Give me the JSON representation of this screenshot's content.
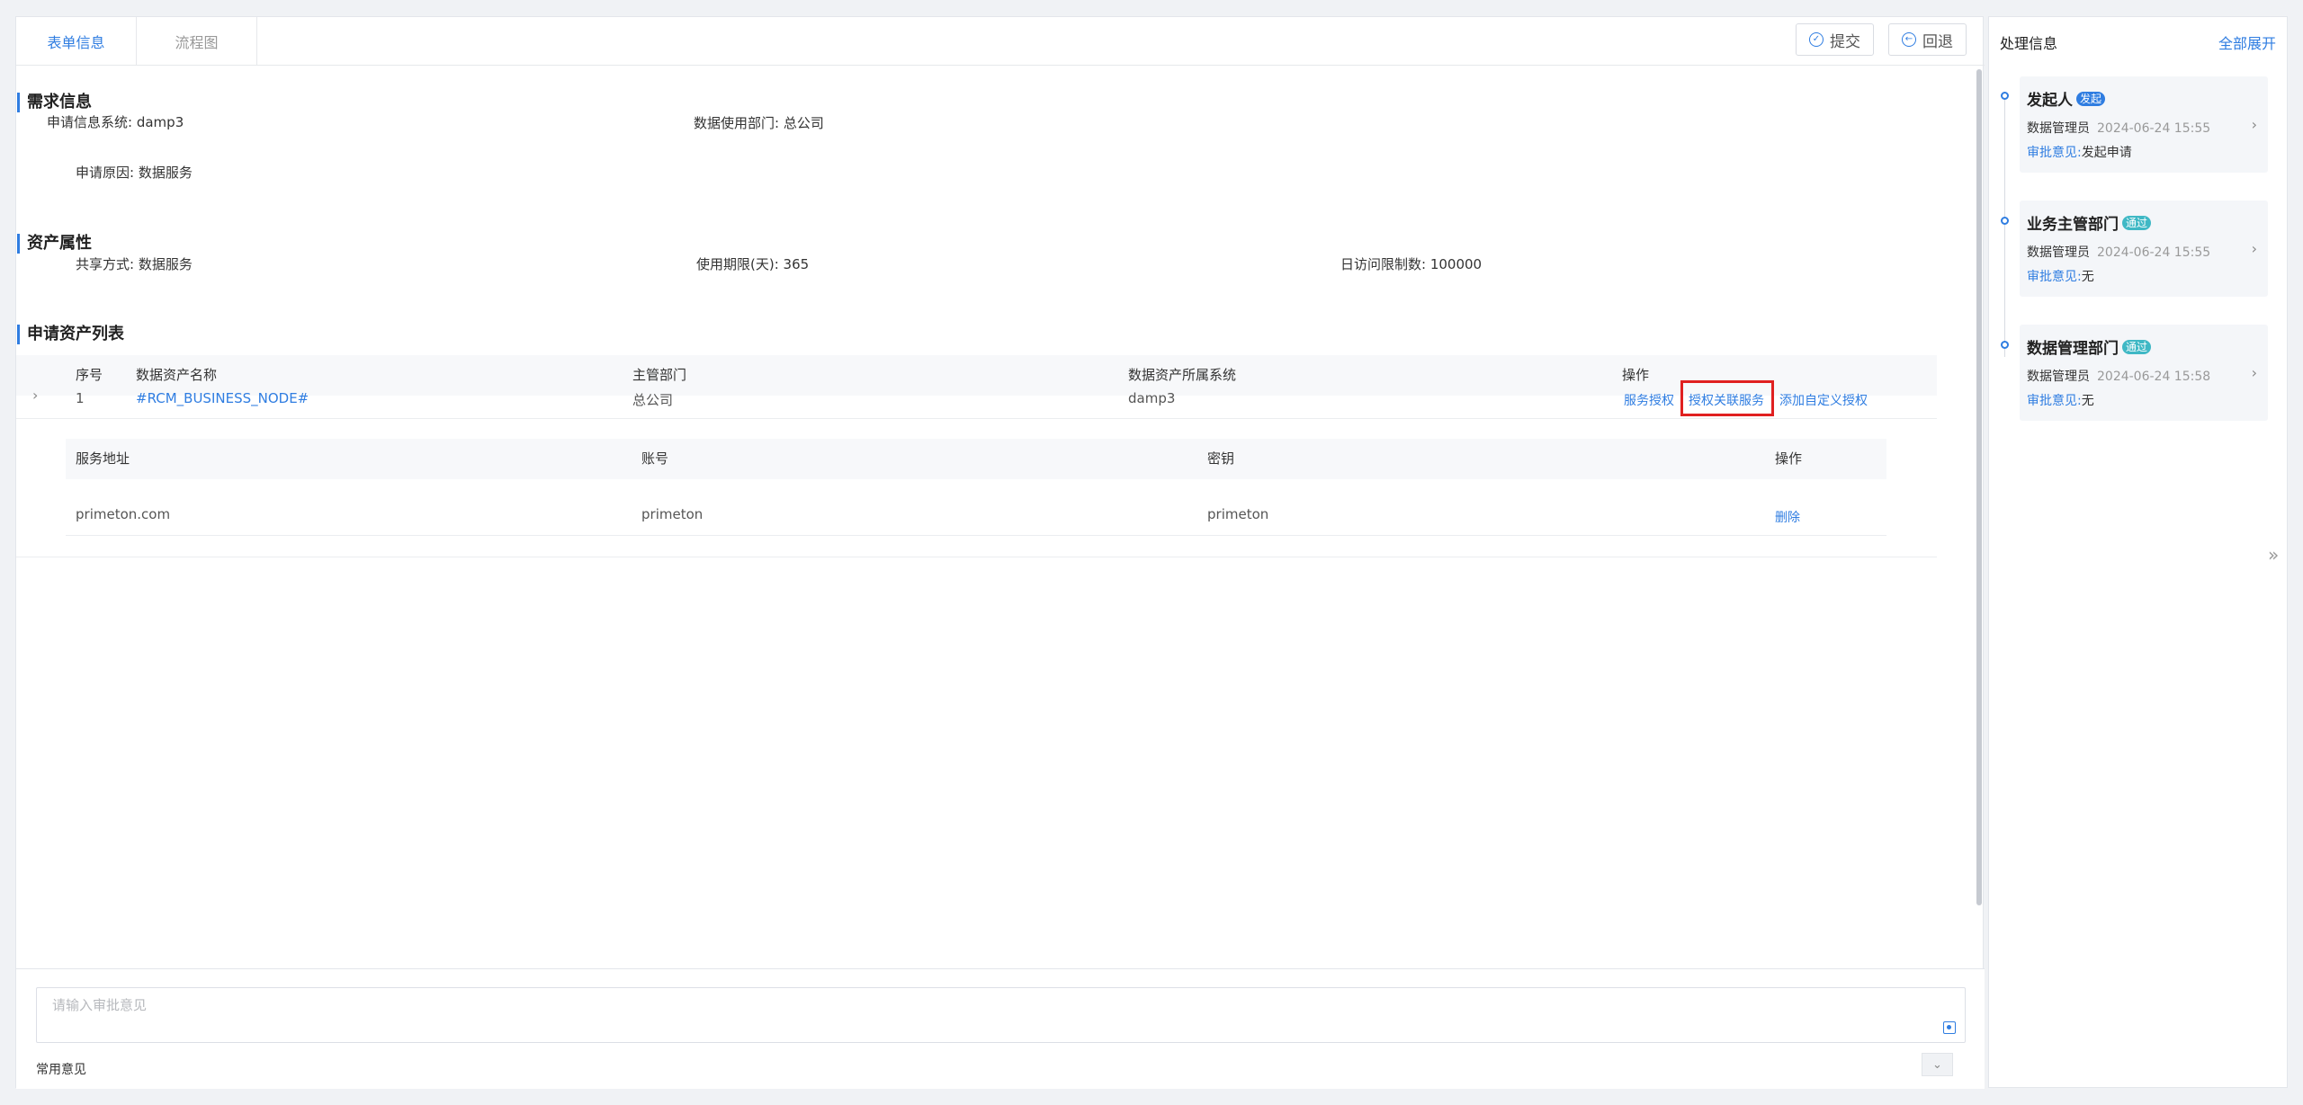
{
  "tabs": [
    {
      "label": "表单信息",
      "active": true
    },
    {
      "label": "流程图",
      "active": false
    }
  ],
  "toolbar": {
    "submit_label": "提交",
    "back_label": "回退"
  },
  "demand": {
    "title": "需求信息",
    "system_label": "申请信息系统:",
    "system_value": "damp3",
    "dept_label": "数据使用部门:",
    "dept_value": "总公司",
    "reason_label": "申请原因:",
    "reason_value": "数据服务"
  },
  "asset_attr": {
    "title": "资产属性",
    "share_label": "共享方式:",
    "share_value": "数据服务",
    "period_label": "使用期限(天):",
    "period_value": "365",
    "limit_label": "日访问限制数:",
    "limit_value": "100000"
  },
  "asset_list": {
    "title": "申请资产列表",
    "headers": [
      "序号",
      "数据资产名称",
      "主管部门",
      "数据资产所属系统",
      "操作"
    ],
    "rows": [
      {
        "index": "1",
        "name": "#RCM_BUSINESS_NODE#",
        "dept": "总公司",
        "system": "damp3",
        "actions": [
          "服务授权",
          "授权关联服务",
          "添加自定义授权"
        ]
      }
    ],
    "sub_headers": [
      "服务地址",
      "账号",
      "密钥",
      "操作"
    ],
    "sub_rows": [
      {
        "address": "primeton.com",
        "account": "primeton",
        "secret": "primeton",
        "action": "删除"
      }
    ]
  },
  "opinion": {
    "placeholder": "请输入审批意见",
    "common_label": "常用意见"
  },
  "side": {
    "title": "处理信息",
    "expand_all": "全部展开",
    "cards": [
      {
        "title": "发起人",
        "badge": "发起",
        "badge_color": "#2f7de1",
        "user": "数据管理员",
        "time": "2024-06-24 15:55",
        "op_label": "审批意见:",
        "op_value": "发起申请"
      },
      {
        "title": "业务主管部门",
        "badge": "通过",
        "badge_color": "#3fb8c5",
        "user": "数据管理员",
        "time": "2024-06-24 15:55",
        "op_label": "审批意见:",
        "op_value": "无"
      },
      {
        "title": "数据管理部门",
        "badge": "通过",
        "badge_color": "#3fb8c5",
        "user": "数据管理员",
        "time": "2024-06-24 15:58",
        "op_label": "审批意见:",
        "op_value": "无"
      }
    ]
  }
}
